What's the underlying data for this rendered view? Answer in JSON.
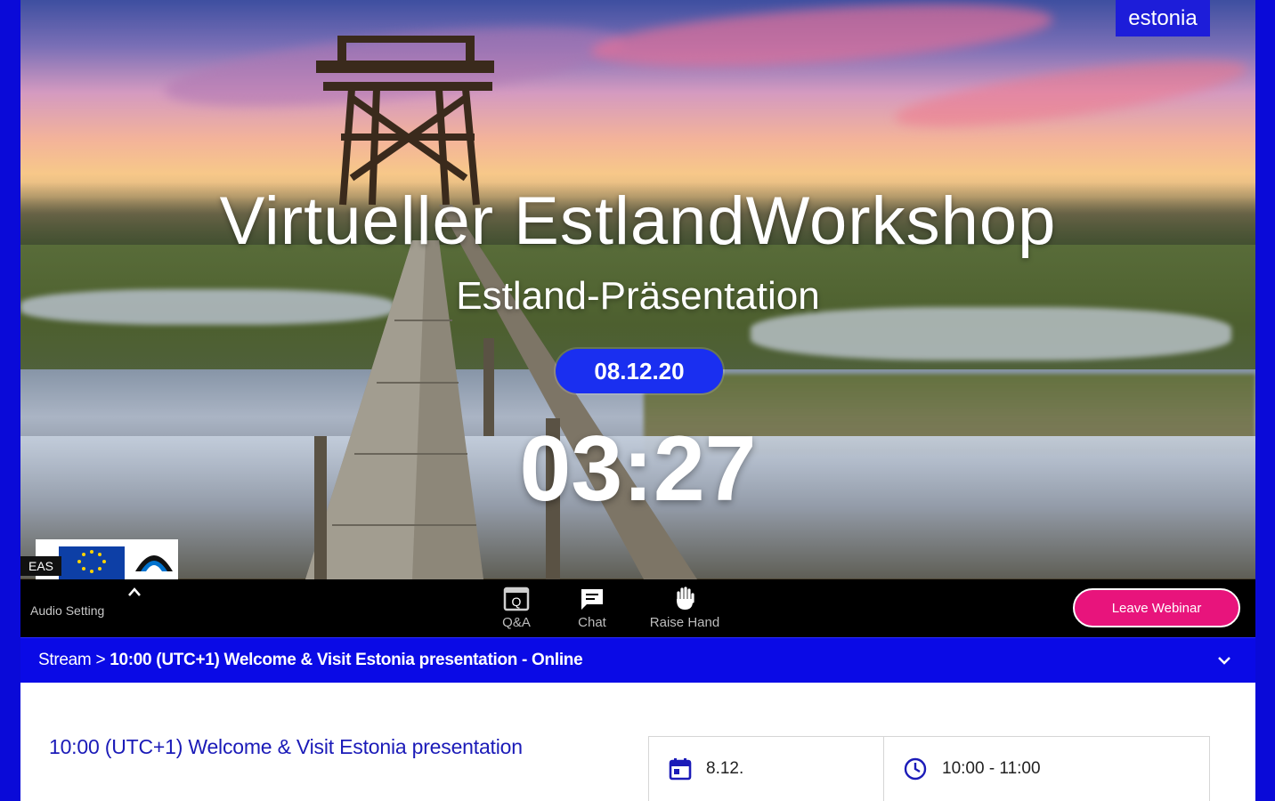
{
  "colors": {
    "accent_blue": "#0a0ae6",
    "leave_button": "#e8147c",
    "title_blue": "#1b1bb8",
    "toolbar_bg": "#000000"
  },
  "stream": {
    "brand_logo_text": "estonia",
    "headline": "Virtueller EstlandWorkshop",
    "subheadline": "Estland-Präsentation",
    "date_badge": "08.12.20",
    "countdown": "03:27",
    "presenter_tag": "EAS"
  },
  "toolbar": {
    "audio_setting_label": "Audio Setting",
    "qa_label": "Q&A",
    "chat_label": "Chat",
    "raise_hand_label": "Raise Hand",
    "leave_label": "Leave Webinar"
  },
  "breadcrumb": {
    "root": "Stream",
    "separator": ">",
    "current": "10:00 (UTC+1) Welcome & Visit Estonia presentation - Online"
  },
  "session": {
    "title": "10:00 (UTC+1) Welcome & Visit Estonia presentation",
    "date": "8.12.",
    "time": "10:00 - 11:00",
    "date_icon": "calendar-icon",
    "time_icon": "clock-icon"
  }
}
